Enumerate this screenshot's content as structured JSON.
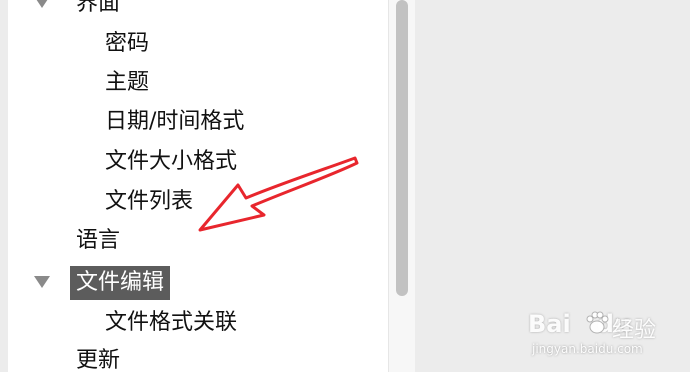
{
  "tree": {
    "items": [
      {
        "label": "界面",
        "expanded": true
      },
      {
        "label": "密码"
      },
      {
        "label": "主题"
      },
      {
        "label": "日期/时间格式"
      },
      {
        "label": "文件大小格式"
      },
      {
        "label": "文件列表"
      },
      {
        "label": "语言"
      },
      {
        "label": "文件编辑",
        "expanded": true,
        "selected": true
      },
      {
        "label": "文件格式关联"
      },
      {
        "label": "更新"
      }
    ]
  },
  "annotation": {
    "arrow_color": "#e8262d"
  },
  "watermark": {
    "brand": "Bai",
    "brand_suffix": "du",
    "product": "经验",
    "url": "jingyan.baidu.com"
  },
  "colors": {
    "selection_bg": "#5c5c5c",
    "selection_fg": "#ffffff",
    "pane_bg": "#ececec"
  }
}
